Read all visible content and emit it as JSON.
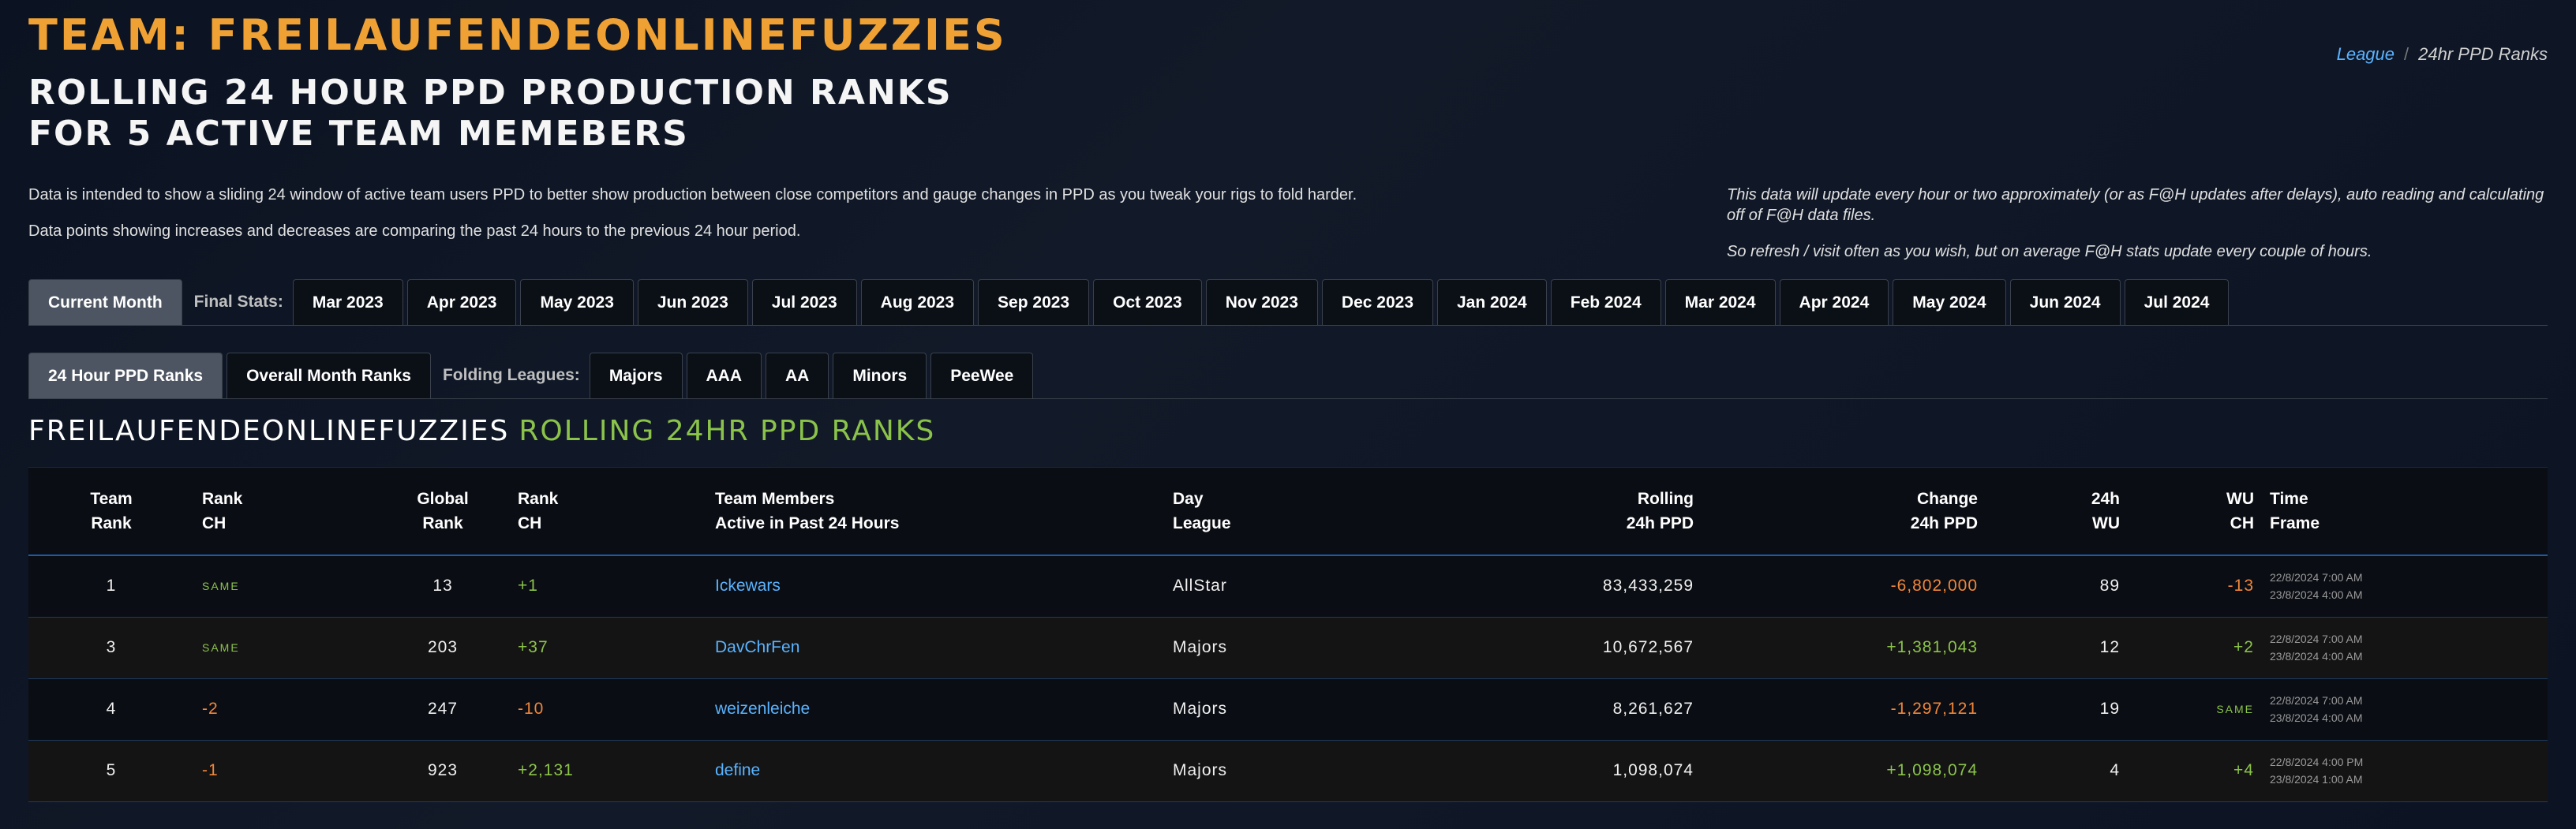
{
  "header": {
    "team_title": "TEAM: FREILAUFENDEONLINEFUZZIES",
    "subtitle_line1": "ROLLING 24 HOUR PPD PRODUCTION RANKS",
    "subtitle_line2": "FOR 5 ACTIVE TEAM MEMEBERS"
  },
  "breadcrumb": {
    "link": "League",
    "separator": "/",
    "current": "24hr PPD Ranks"
  },
  "description": {
    "left_p1": "Data is intended to show a sliding 24 window of active team users PPD to better show production between close competitors and gauge changes in PPD as you tweak your rigs to fold harder.",
    "left_p2": "Data points showing increases and decreases are comparing the past 24 hours to the previous 24 hour period.",
    "right_p1": "This data will update every hour or two approximately (or as F@H updates after delays), auto reading and calculating off of F@H data files.",
    "right_p2": "So refresh / visit often as you wish, but on average F@H stats update every couple of hours."
  },
  "tabs_row1": {
    "current": "Current Month",
    "label": "Final Stats:",
    "months": [
      "Mar 2023",
      "Apr 2023",
      "May 2023",
      "Jun 2023",
      "Jul 2023",
      "Aug 2023",
      "Sep 2023",
      "Oct 2023",
      "Nov 2023",
      "Dec 2023",
      "Jan 2024",
      "Feb 2024",
      "Mar 2024",
      "Apr 2024",
      "May 2024",
      "Jun 2024",
      "Jul 2024"
    ]
  },
  "tabs_row2": {
    "ranks_24h": "24 Hour PPD Ranks",
    "overall": "Overall Month Ranks",
    "label": "Folding Leagues:",
    "leagues": [
      "Majors",
      "AAA",
      "AA",
      "Minors",
      "PeeWee"
    ]
  },
  "section": {
    "team_name": "FREILAUFENDEONLINEFUZZIES",
    "title_accent": "ROLLING 24HR PPD RANKS"
  },
  "table": {
    "headers": {
      "team_rank_1": "Team",
      "team_rank_2": "Rank",
      "rank_ch_1": "Rank",
      "rank_ch_2": "CH",
      "global_rank_1": "Global",
      "global_rank_2": "Rank",
      "rank_ch2_1": "Rank",
      "rank_ch2_2": "CH",
      "members_1": "Team Members",
      "members_2": "Active in Past 24 Hours",
      "day_league_1": "Day",
      "day_league_2": "League",
      "rolling_1": "Rolling",
      "rolling_2": "24h PPD",
      "change_1": "Change",
      "change_2": "24h PPD",
      "wu_1": "24h",
      "wu_2": "WU",
      "wu_ch_1": "WU",
      "wu_ch_2": "CH",
      "time_1": "Time",
      "time_2": "Frame"
    },
    "rows": [
      {
        "team_rank": "1",
        "rank_ch": "SAME",
        "global_rank": "13",
        "global_rank_ch": "+1",
        "member": "Ickewars",
        "league": "AllStar",
        "rolling": "83,433,259",
        "change": "-6,802,000",
        "wu": "89",
        "wu_ch": "-13",
        "time_from": "22/8/2024 7:00 AM",
        "time_to": "23/8/2024 4:00 AM"
      },
      {
        "team_rank": "3",
        "rank_ch": "SAME",
        "global_rank": "203",
        "global_rank_ch": "+37",
        "member": "DavChrFen",
        "league": "Majors",
        "rolling": "10,672,567",
        "change": "+1,381,043",
        "wu": "12",
        "wu_ch": "+2",
        "time_from": "22/8/2024 7:00 AM",
        "time_to": "23/8/2024 4:00 AM"
      },
      {
        "team_rank": "4",
        "rank_ch": "-2",
        "global_rank": "247",
        "global_rank_ch": "-10",
        "member": "weizenleiche",
        "league": "Majors",
        "rolling": "8,261,627",
        "change": "-1,297,121",
        "wu": "19",
        "wu_ch": "SAME",
        "time_from": "22/8/2024 7:00 AM",
        "time_to": "23/8/2024 4:00 AM"
      },
      {
        "team_rank": "5",
        "rank_ch": "-1",
        "global_rank": "923",
        "global_rank_ch": "+2,131",
        "member": "define",
        "league": "Majors",
        "rolling": "1,098,074",
        "change": "+1,098,074",
        "wu": "4",
        "wu_ch": "+4",
        "time_from": "22/8/2024 4:00 PM",
        "time_to": "23/8/2024 1:00 AM"
      }
    ]
  },
  "colors": {
    "accent_orange": "#f0a133",
    "positive_green": "#8bc34a",
    "negative_orange": "#f0863a",
    "link_blue": "#5ab3ff",
    "header_border_blue": "#1d5ba8"
  }
}
